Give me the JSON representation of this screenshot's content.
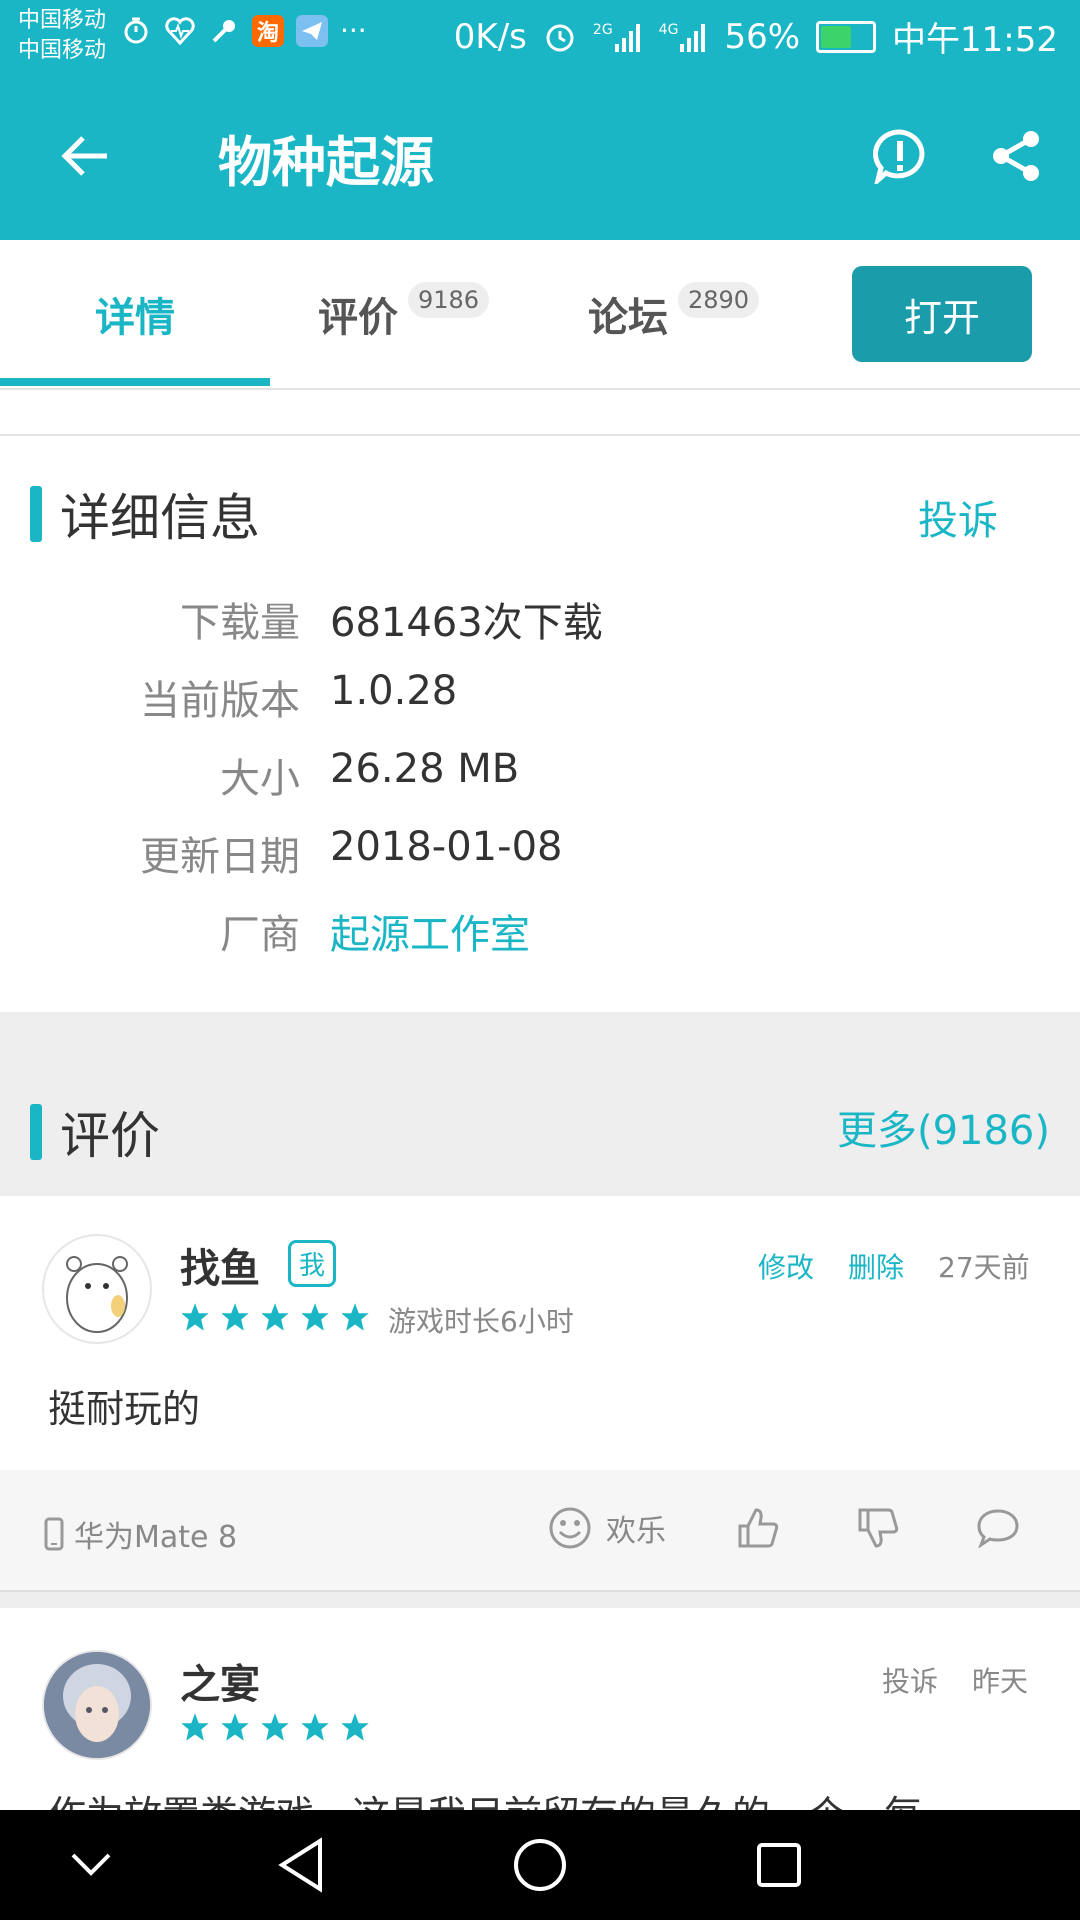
{
  "status_bar": {
    "carrier_1": "中国移动",
    "carrier_2": "中国移动",
    "more": "···",
    "net_speed": "0K/s",
    "net_2g": "2G",
    "net_4g": "4G",
    "battery": "56%",
    "time": "中午11:52",
    "taobao_label": "淘"
  },
  "app_bar": {
    "title": "物种起源"
  },
  "tabs": {
    "details": "详情",
    "reviews": "评价",
    "reviews_count": "9186",
    "forum": "论坛",
    "forum_count": "2890",
    "open_button": "打开"
  },
  "details": {
    "title": "详细信息",
    "report": "投诉",
    "rows": [
      {
        "key": "下载量",
        "value": "681463次下载"
      },
      {
        "key": "当前版本",
        "value": "1.0.28"
      },
      {
        "key": "大小",
        "value": "26.28 MB"
      },
      {
        "key": "更新日期",
        "value": "2018-01-08"
      },
      {
        "key": "厂商",
        "value": "起源工作室"
      }
    ]
  },
  "reviews": {
    "title": "评价",
    "more": "更多(9186)",
    "items": [
      {
        "user": "找鱼",
        "me_badge": "我",
        "edit": "修改",
        "delete": "删除",
        "time": "27天前",
        "rating": 5,
        "playtime": "游戏时长6小时",
        "text": "挺耐玩的",
        "device": "华为Mate 8",
        "mood": "欢乐"
      },
      {
        "user": "之宴",
        "report": "投诉",
        "time": "昨天",
        "rating": 5,
        "text": "作为放置类游戏，这是我目前留存的最久的一个，每"
      }
    ]
  },
  "colors": {
    "accent": "#1bb6c6",
    "open_button": "#1b9cab"
  }
}
